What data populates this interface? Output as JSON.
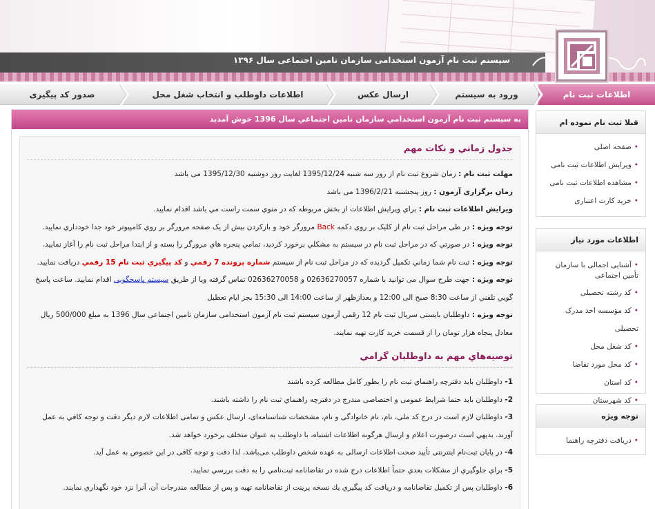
{
  "header": {
    "title": "سیستم ثبت نام آزمون استخدامی سازمان تامین اجتماعی سال ۱۳۹۶"
  },
  "nav": {
    "tabs": [
      {
        "label": "اطلاعات ثبت نام",
        "active": true
      },
      {
        "label": "ورود به سیستم",
        "active": false
      },
      {
        "label": "ارسال عکس",
        "active": false
      },
      {
        "label": "اطلاعات داوطلب و انتخاب شغل محل",
        "active": false
      },
      {
        "label": "صدور کد پیگیری",
        "active": false
      }
    ]
  },
  "main": {
    "welcome": "به سيستم ثبت نام آزمون استخدامي سازمان تامين اجتماعي سال 1396 خوش آمديد",
    "schedule_title": "جدول زماني و نکات مهم",
    "items": {
      "reg_label": "مهلت ثبت نام :",
      "reg_text": "زمان شروع ثبت نام از روز سه شنبه 1395/12/24 لغایت روز دوشنبه 1395/12/30 می باشد",
      "exam_label": "زمان برگزاری آزمون :",
      "exam_text": "روز پنجشنبه 1396/2/21 می باشد",
      "edit_label": "ويرايش اطلاعات ثبت نام :",
      "edit_text": "براي ويرايش اطلاعات از بخش مربوطه که در منوي سمت راست مي باشد اقدام نماييد.",
      "note_label": "توجه ويژه :",
      "note1_a": "در طی مراحل ثبت نام از کلیک بر روي دکمه",
      "note1_back": "Back",
      "note1_b": "مرورگر خود و بازکردن بيش از يک صفحه مرورگر بر روي کامپيوتر خود جدا خودداري نماييد.",
      "note2": "در صورتي که در مراحل ثبت نام در سيستم به مشکلي برخورد کرديد، تمامي پنجره هاي مرورگر را بسته و از ابتدا مراحل ثبت نام را آغاز نماييد.",
      "note3_a": "ثبت نام شما زماني تکميل گرديده که در مراحل ثبت نام از سيستم",
      "note3_file": "شماره پرونده 7 رقمي",
      "note3_and": "و",
      "note3_code": "کد پيگيري ثبت نام 15 رقمي",
      "note3_b": "دريافت نماييد.",
      "note4_a": "جهت طرح سوال می توانید با شماره 02636270057 و 02636270058 تماس گرفته ویا از طریق",
      "note4_link": "سیستم پاسخگویی",
      "note4_b": "اقدام نمایید. ساعت پاسخ",
      "note4_c": "گويي تلفني از ساعت 8:30 صبح الی 12:00 و بعدازظهر از ساعت 14:00 الی 15:30 بجز ایام تعطیل",
      "note5_a": "داوطلبان بايستی سريال ثبت نام 12 رقمی آزمون سیستم ثبت نام آزمون استخدامی سازمان تامین اجتماعی سال 1396 به مبلغ 500/000 ريال",
      "note5_b": "معادل پنجاه هزار تومان را از قسمت خرید کارت تهیه نمایند."
    },
    "rec_title": "توصیه‌هاي مهم به داوطلبان گرامي",
    "recs": [
      {
        "num": "1-",
        "text": "داوطلبان باید دفترچه راهنماي ثبت نام را بطور کامل مطالعه کرده باشند"
      },
      {
        "num": "2-",
        "text": "داوطلبان باید حتما شرایط عمومی و اختصاصی مندرج در دفترچه راهنماي ثبت نام را داشته باشند."
      },
      {
        "num": "3-",
        "text": "داوطلبان لازم است در درج کد ملی، نام، نام خانوادگی و نام، مشخصات شناسنامه‌ای، ارسال عکس و تمامی اطلاعات لازم دیگر دقت و توجه کافي به عمل",
        "text2": "آورند. بديهي است درصورت اعلام و ارسال هرگونه اطلاعات اشتباه، با داوطلب به عنوان متخلف برخورد خواهد شد."
      },
      {
        "num": "4-",
        "text": "در پایان ثبت‌نام اینترنتی تأیید صحت اطلاعات ارسالی به عهده شخص داوطلب می‌باشد، لذا دقت و توجه کافی در این خصوص به عمل آید."
      },
      {
        "num": "5-",
        "text": "براي جلوگيري از مشكلات بعدي حتماً اطلاعات درج شده در تقاضانامه ثبت‌نامي را به دقت بررسي نماييد."
      },
      {
        "num": "6-",
        "text": "داوطلبان پس از تکميل تقاضانامه و دريافت کد پيگيري يك نسخه پرينت از تقاضانامه تهيه و پس از مطالعه مندرجات آن، آنرا نزد خود نگهداري نمايند."
      }
    ]
  },
  "sidebar": {
    "box1": {
      "title": "قبلا ثبت نام نموده ام",
      "items": [
        "صفحه اصلی",
        "ویرایش اطلاعات ثبت نامی",
        "مشاهده اطلاعات ثبت نامی",
        "خرید کارت اعتباری"
      ]
    },
    "box2": {
      "title": "اطلاعات مورد نياز",
      "items": [
        "آشنایی اجمالی با سازمان تأمین اجتماعی",
        "کد رشته تحصیلی",
        "کد مؤسسه اخذ مدرک تحصیلی",
        "کد شغل محل",
        "کد محل مورد تقاضا",
        "کد استان",
        "کد شهرستان"
      ]
    },
    "box3": {
      "title": "توجه ويژه",
      "items": [
        "دریافت دفترچه راهنما"
      ]
    }
  }
}
